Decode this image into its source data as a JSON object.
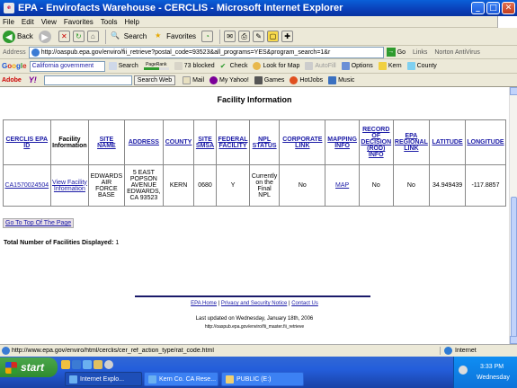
{
  "window": {
    "title": "EPA - Envirofacts Warehouse - CERCLIS - Microsoft Internet Explorer",
    "minimize": "_",
    "maximize": "□",
    "close": "✕"
  },
  "menu": [
    "File",
    "Edit",
    "View",
    "Favorites",
    "Tools",
    "Help"
  ],
  "toolbar": {
    "back": "Back",
    "search": "Search",
    "favorites": "Favorites"
  },
  "address": {
    "label": "Address",
    "url": "http://oaspub.epa.gov/enviro/fii_retrieve?postal_code=93523&all_programs=YES&program_search=1&r",
    "go": "Go",
    "links": "Links",
    "antivirus": "Norton AntiVirus"
  },
  "google_bar": {
    "logo": [
      "G",
      "o",
      "o",
      "g",
      "l",
      "e"
    ],
    "search_value": "California government",
    "search": "Search",
    "pagerank": "PageRank",
    "blocked": "73 blocked",
    "check": "Check",
    "look_for_map": "Look for Map",
    "autofill": "AutoFill",
    "options": "Options",
    "kern": "Kern",
    "county": "County"
  },
  "yahoo_bar": {
    "adobe": "Adobe",
    "yahoo": "Y!",
    "search_web": "Search Web",
    "mail": "Mail",
    "my_yahoo": "My Yahoo!",
    "games": "Games",
    "hotjobs": "HotJobs",
    "music": "Music"
  },
  "page": {
    "title": "Facility Information",
    "headers": [
      "CERCLIS EPA ID",
      "Facility Information",
      "SITE NAME",
      "ADDRESS",
      "COUNTY",
      "SITE SMSA",
      "FEDERAL FACILITY",
      "NPL STATUS",
      "CORPORATE LINK",
      "MAPPING INFO",
      "RECORD OF DECISION (ROD) INFO",
      "EPA REGIONAL LINK",
      "LATITUDE",
      "LONGITUDE"
    ],
    "row": {
      "epa_id": "CA1570024504",
      "facility_info": "View Facility Information",
      "site_name": "EDWARDS AIR FORCE BASE",
      "address": "5 EAST POPSON AVENUE EDWARDS, CA 93523",
      "county": "KERN",
      "smsa": "0680",
      "federal": "Y",
      "npl_status": "Currently on the Final NPL",
      "corporate": "No",
      "mapping": "MAP",
      "rod": "No",
      "regional": "No",
      "latitude": "34.949439",
      "longitude": "-117.8857"
    },
    "top_link": "Go To Top Of The Page",
    "total_label": "Total Number of Facilities Displayed:",
    "total_value": "1",
    "footer_links": [
      "EPA Home",
      "Privacy and Security Notice",
      "Contact Us"
    ],
    "updated": "Last updated on Wednesday, January 18th, 2006",
    "page_url": "http://oaspub.epa.gov/enviro/fii_master.fii_retrieve"
  },
  "status": {
    "text": "http://www.epa.gov/enviro/html/cerclis/cer_ref_action_type/rat_code.html",
    "zone": "Internet"
  },
  "taskbar": {
    "start": "start",
    "tasks": [
      "Internet Explo...",
      "Kern Co. CA Rese...",
      "PUBLIC (E:)"
    ],
    "time": "3:33 PM",
    "day": "Wednesday"
  }
}
